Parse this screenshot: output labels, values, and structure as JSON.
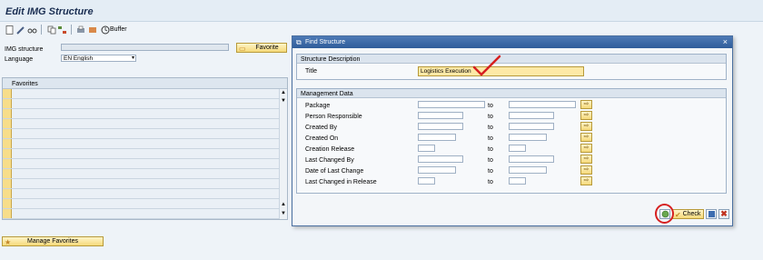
{
  "window": {
    "title": "Edit IMG Structure"
  },
  "toolbar": {
    "buffer_label": "Buffer",
    "icons": [
      "new-icon",
      "edit-icon",
      "glasses-icon",
      "copy-icon",
      "tree-icon",
      "print-icon",
      "print-preview-icon",
      "buffer-icon"
    ]
  },
  "form": {
    "img_structure_label": "IMG structure",
    "img_structure_value": "",
    "favorite_button": "Favorite",
    "language_label": "Language",
    "language_value": "EN English"
  },
  "favorites": {
    "header": "Favorites",
    "rows": 13,
    "manage_button": "Manage Favorites"
  },
  "dialog": {
    "title": "Find Structure",
    "structure_description": {
      "header": "Structure Description",
      "title_label": "Title",
      "title_value": "Logistics Execution"
    },
    "management_data": {
      "header": "Management Data",
      "to_label": "to",
      "rows": [
        {
          "label": "Package"
        },
        {
          "label": "Person Responsible"
        },
        {
          "label": "Created By"
        },
        {
          "label": "Created On"
        },
        {
          "label": "Creation Release"
        },
        {
          "label": "Last Changed By"
        },
        {
          "label": "Date of Last Change"
        },
        {
          "label": "Last Changed in Release"
        }
      ]
    },
    "footer": {
      "check_label": "Check"
    }
  },
  "colors": {
    "dialog_title_bg": "#2f5d9a",
    "highlight_field": "#fde9a6",
    "annotation_red": "#d62020"
  }
}
